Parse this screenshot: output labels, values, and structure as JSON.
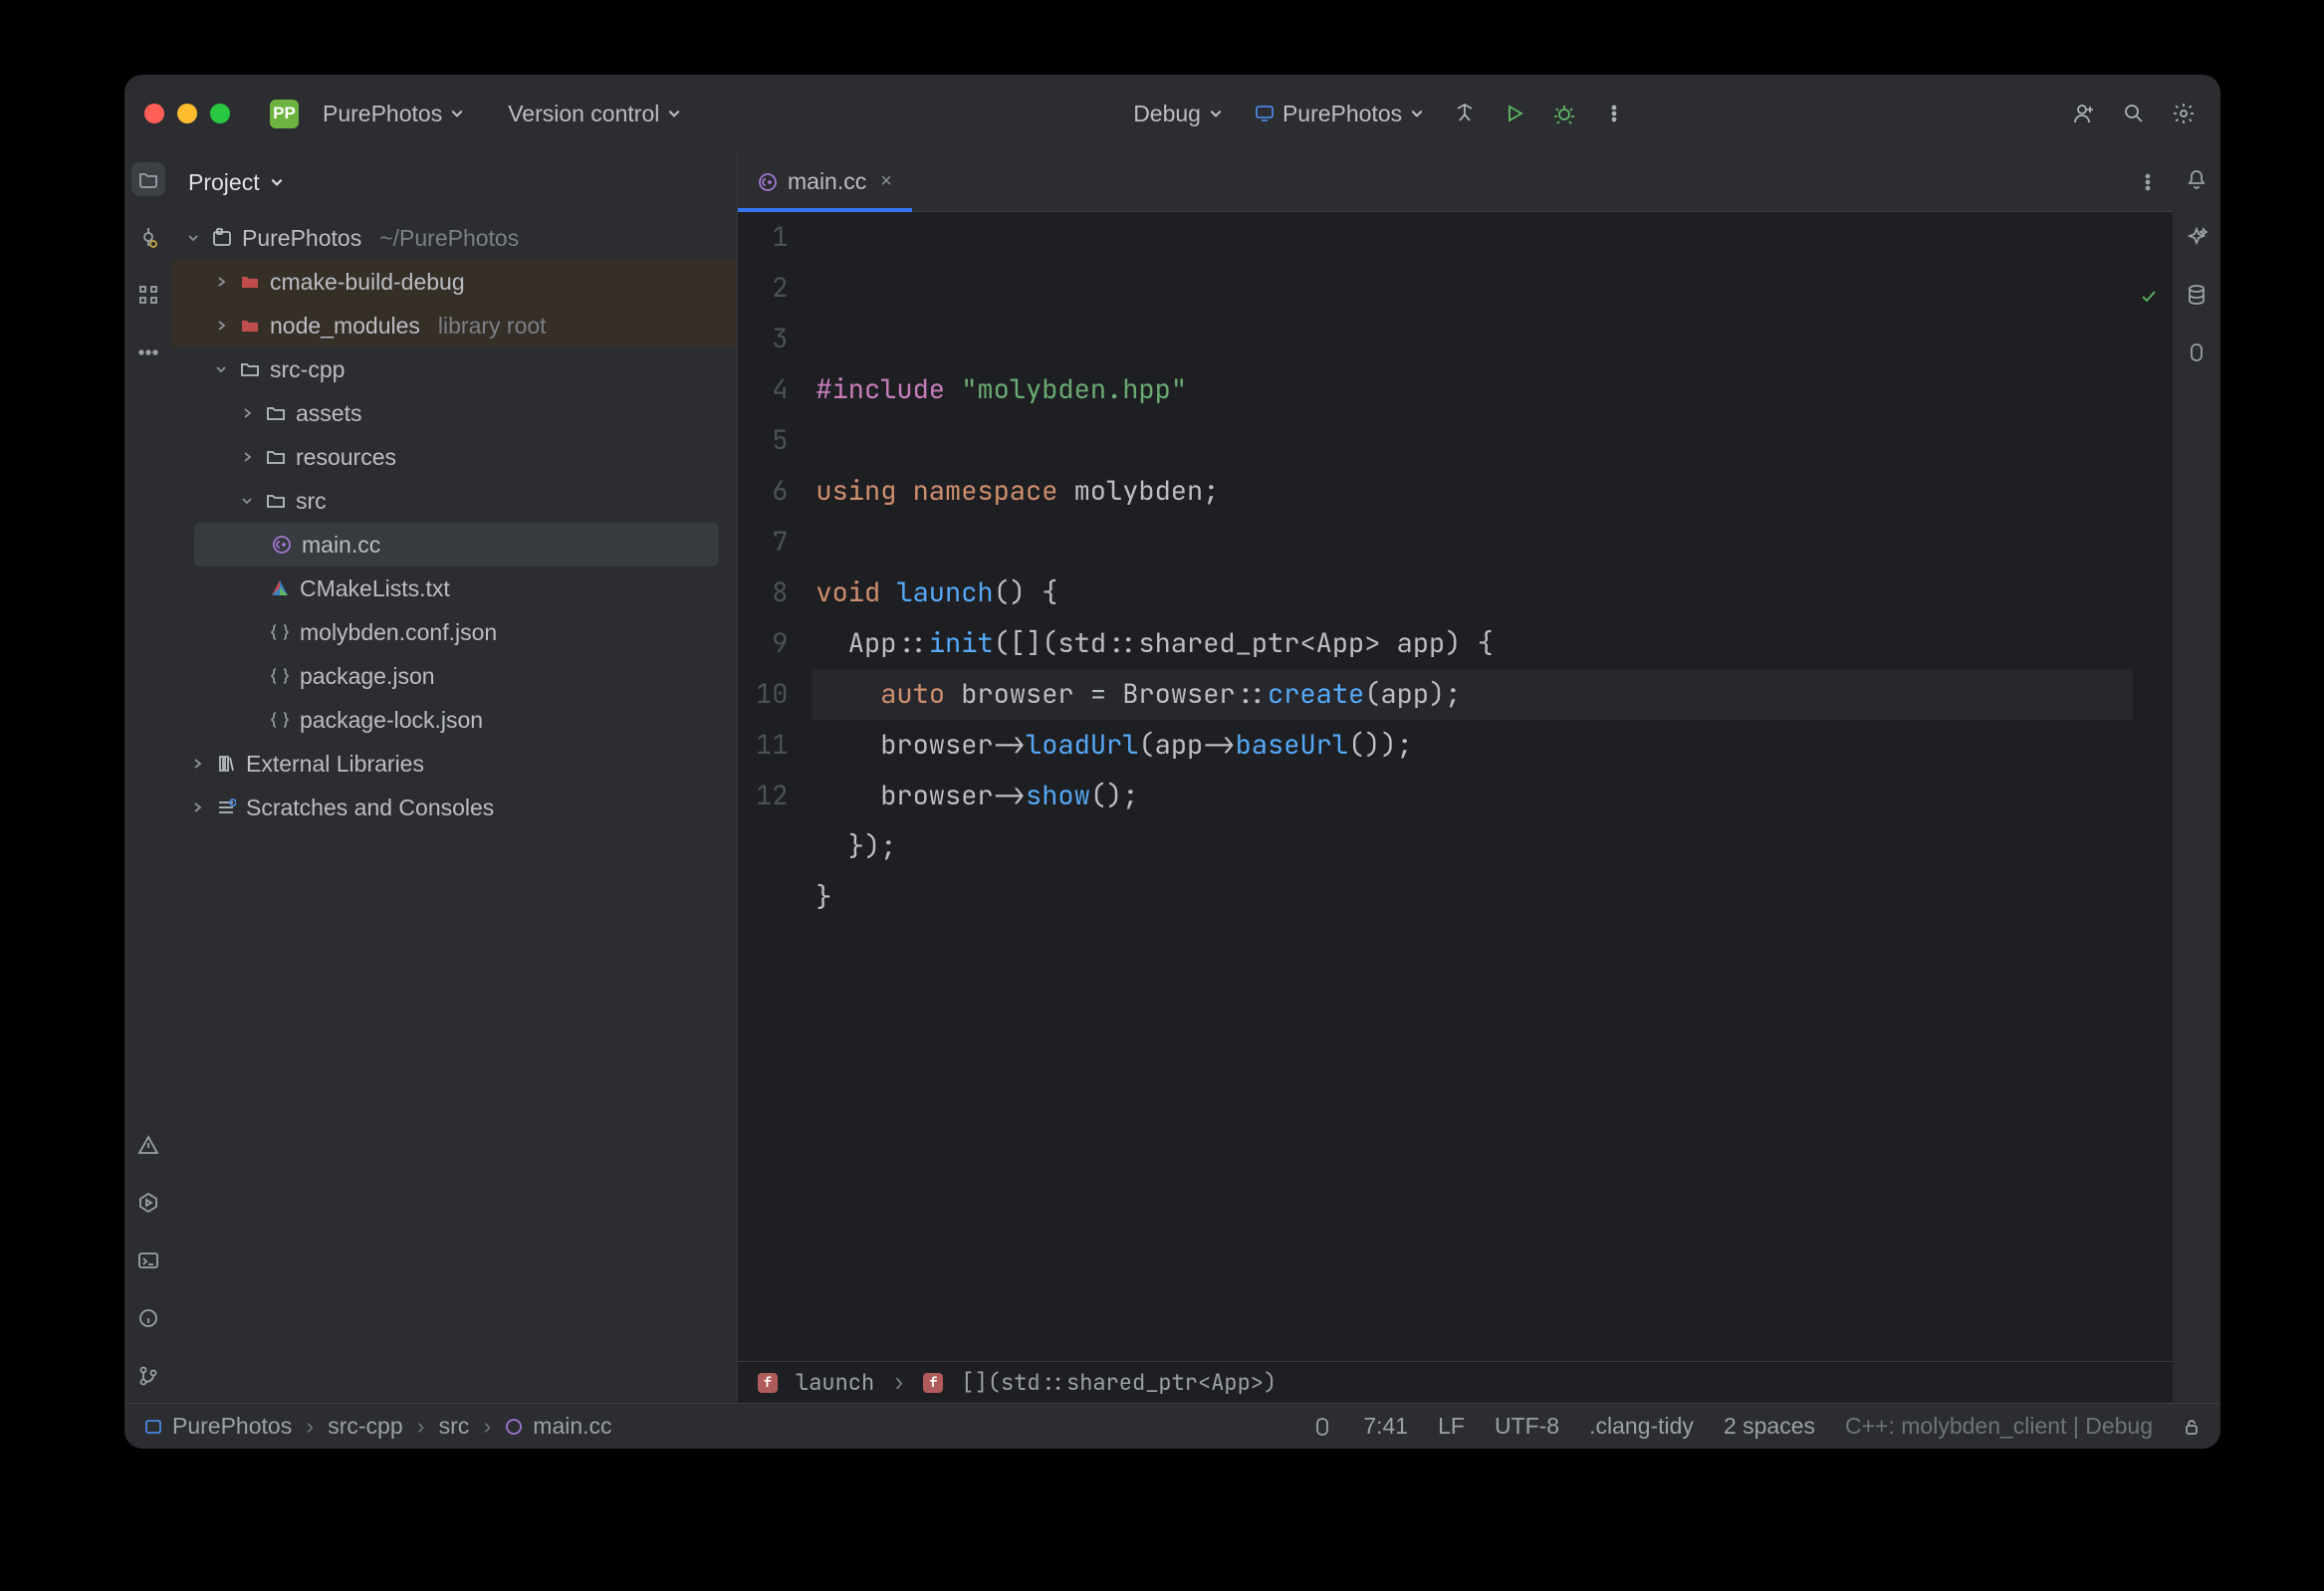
{
  "titlebar": {
    "project_badge": "PP",
    "project_name": "PurePhotos",
    "version_control": "Version control",
    "config": "Debug",
    "target": "PurePhotos"
  },
  "sidebar": {
    "title": "Project",
    "root": {
      "name": "PurePhotos",
      "path": "~/PurePhotos"
    },
    "items": [
      {
        "label": "cmake-build-debug",
        "type": "folder-red"
      },
      {
        "label": "node_modules",
        "suffix": "library root",
        "type": "folder-red"
      },
      {
        "label": "src-cpp",
        "type": "folder"
      },
      {
        "label": "assets",
        "type": "folder"
      },
      {
        "label": "resources",
        "type": "folder"
      },
      {
        "label": "src",
        "type": "folder"
      },
      {
        "label": "main.cc",
        "type": "cpp",
        "selected": true
      },
      {
        "label": "CMakeLists.txt",
        "type": "cmake"
      },
      {
        "label": "molybden.conf.json",
        "type": "json"
      },
      {
        "label": "package.json",
        "type": "json"
      },
      {
        "label": "package-lock.json",
        "type": "json"
      },
      {
        "label": "External Libraries",
        "type": "lib"
      },
      {
        "label": "Scratches and Consoles",
        "type": "scratch"
      }
    ]
  },
  "tab": {
    "filename": "main.cc"
  },
  "code": {
    "lines": [
      {
        "n": "1",
        "segs": [
          [
            "pp",
            "#include "
          ],
          [
            "str",
            "\"molybden.hpp\""
          ]
        ]
      },
      {
        "n": "2",
        "segs": []
      },
      {
        "n": "3",
        "segs": [
          [
            "kw",
            "using namespace "
          ],
          [
            "id",
            "molybden;"
          ]
        ]
      },
      {
        "n": "4",
        "segs": []
      },
      {
        "n": "5",
        "segs": [
          [
            "kw",
            "void "
          ],
          [
            "fn",
            "launch"
          ],
          [
            "id",
            "() {"
          ]
        ]
      },
      {
        "n": "6",
        "segs": [
          [
            "id",
            "  App::"
          ],
          [
            "fn",
            "init"
          ],
          [
            "id",
            "([](std::shared_ptr<App> app) {"
          ]
        ]
      },
      {
        "n": "7",
        "hl": true,
        "segs": [
          [
            "id",
            "    "
          ],
          [
            "kw",
            "auto "
          ],
          [
            "id",
            "browser = Browser::"
          ],
          [
            "fn",
            "create"
          ],
          [
            "id",
            "("
          ],
          [
            "id",
            "app"
          ],
          [
            "id",
            ");"
          ]
        ]
      },
      {
        "n": "8",
        "segs": [
          [
            "id",
            "    browser->"
          ],
          [
            "fn",
            "loadUrl"
          ],
          [
            "id",
            "("
          ],
          [
            "id",
            "app"
          ],
          [
            "id",
            "->"
          ],
          [
            "fn",
            "baseUrl"
          ],
          [
            "id",
            "());"
          ]
        ]
      },
      {
        "n": "9",
        "segs": [
          [
            "id",
            "    browser->"
          ],
          [
            "fn",
            "show"
          ],
          [
            "id",
            "();"
          ]
        ]
      },
      {
        "n": "10",
        "segs": [
          [
            "id",
            "  });"
          ]
        ]
      },
      {
        "n": "11",
        "segs": [
          [
            "id",
            "}"
          ]
        ]
      },
      {
        "n": "12",
        "segs": []
      }
    ]
  },
  "crumbs": {
    "outer": "launch",
    "inner": "[](std::shared_ptr<App>)"
  },
  "status": {
    "path": [
      "PurePhotos",
      "src-cpp",
      "src",
      "main.cc"
    ],
    "pos": "7:41",
    "eol": "LF",
    "enc": "UTF-8",
    "linter": ".clang-tidy",
    "indent": "2 spaces",
    "config": "C++: molybden_client | Debug"
  }
}
